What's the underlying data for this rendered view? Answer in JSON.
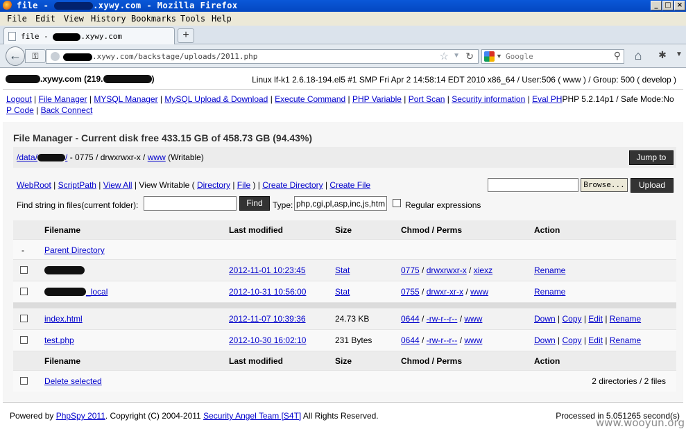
{
  "window": {
    "title_prefix": "file - ",
    "title_suffix": ".xywy.com - Mozilla Firefox",
    "buttons": {
      "minimize": "_",
      "maximize": "□",
      "close": "×"
    }
  },
  "menubar": [
    "File",
    "Edit",
    "View",
    "History",
    "Bookmarks",
    "Tools",
    "Help"
  ],
  "tab": {
    "label_prefix": "file - ",
    "label_suffix": ".xywy.com",
    "new_tab": "+"
  },
  "nav": {
    "url_suffix": ".xywy.com/backstage/uploads/2011.php",
    "search_placeholder": "Google"
  },
  "host": {
    "hostname_suffix": ".xywy.com (219.",
    "hostname_end": ")",
    "sysinfo": "Linux lf-k1 2.6.18-194.el5 #1 SMP Fri Apr 2 14:58:14 EDT 2010 x86_64 / User:506 ( www ) / Group: 500 ( develop )"
  },
  "toplinks": {
    "items": [
      "Logout",
      "File Manager",
      "MYSQL Manager",
      "MySQL Upload & Download",
      "Execute Command",
      "PHP Variable",
      "Port Scan",
      "Security information",
      "Eval PH"
    ],
    "info": "PHP 5.2.14p1 / Safe Mode:No",
    "wrap_link": "P Code",
    "last": "Back Connect"
  },
  "filemanager": {
    "title": "File Manager - Current disk free 433.15 GB of 458.73 GB (94.43%)",
    "path_link": "/data/",
    "path_link_end": "/",
    "perm_text": " - 0775 / drwxrwxr-x / ",
    "owner": "www",
    "writable": " (Writable)",
    "jump_button": "Jump to",
    "links": {
      "webroot": "WebRoot",
      "scriptpath": "ScriptPath",
      "viewall": "View All",
      "viewwritable": "View Writable (",
      "directory": "Directory",
      "file": "File",
      "closeparen": ")",
      "createdir": "Create Directory",
      "createfile": "Create File"
    },
    "browse_button": "Browse...",
    "upload_button": "Upload",
    "find_label": "Find string in files(current folder):",
    "find_button": "Find",
    "type_label": "Type:",
    "type_value": "php,cgi,pl,asp,inc,js,htm",
    "regex_label": "Regular expressions"
  },
  "table": {
    "columns": [
      "Filename",
      "Last modified",
      "Size",
      "Chmod / Perms",
      "Action"
    ],
    "parent": {
      "dash": "-",
      "label": "Parent Directory"
    },
    "dirs": [
      {
        "name_suffix": "",
        "modified": "2012-11-01 10:23:45",
        "size": "Stat",
        "chmod": "0775",
        "perms": "drwxrwxr-x",
        "owner": "xiexz",
        "action": "Rename"
      },
      {
        "name_suffix": "_local",
        "modified": "2012-10-31 10:56:00",
        "size": "Stat",
        "chmod": "0755",
        "perms": "drwxr-xr-x",
        "owner": "www",
        "action": "Rename"
      }
    ],
    "files": [
      {
        "name": "index.html",
        "modified": "2012-11-07 10:39:36",
        "size": "24.73 KB",
        "chmod": "0644",
        "perms": "-rw-r--r--",
        "owner": "www",
        "actions": [
          "Down",
          "Copy",
          "Edit",
          "Rename"
        ]
      },
      {
        "name": "test.php",
        "modified": "2012-10-30 16:02:10",
        "size": "231 Bytes",
        "chmod": "0644",
        "perms": "-rw-r--r--",
        "owner": "www",
        "actions": [
          "Down",
          "Copy",
          "Edit",
          "Rename"
        ]
      }
    ],
    "delete_selected": "Delete selected",
    "summary": "2 directories / 2 files"
  },
  "footer": {
    "powered_prefix": "Powered by ",
    "phpspy": "PhpSpy 2011",
    "copyright": ". Copyright (C) 2004-2011 ",
    "team": "Security Angel Team [S4T]",
    "rights": " All Rights Reserved.",
    "processed": "Processed in 5.051265 second(s)"
  },
  "watermark": "www.wooyun.org",
  "colors": {
    "titlebar": "#0346c1",
    "link": "#0000cc",
    "button_dark": "#333333"
  }
}
